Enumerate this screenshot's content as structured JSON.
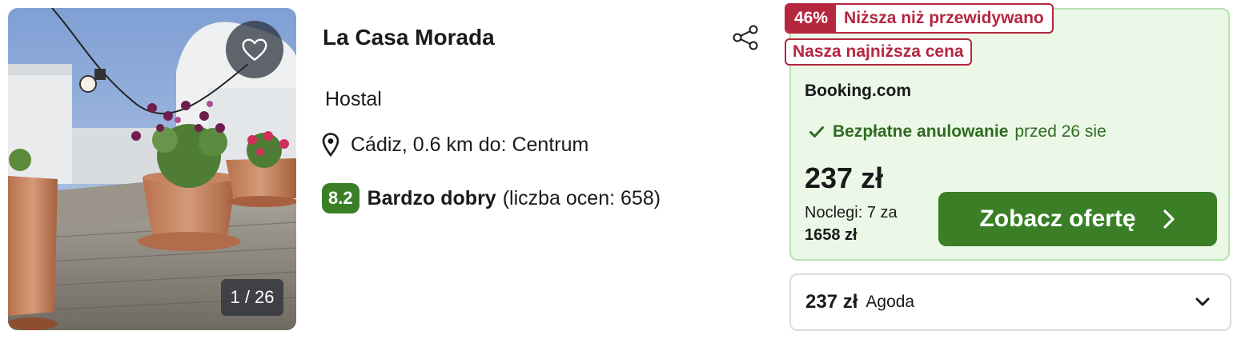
{
  "hotel": {
    "name": "La Casa Morada",
    "type": "Hostal",
    "location": "Cádiz, 0.6 km do: Centrum",
    "rating": {
      "score": "8.2",
      "label": "Bardzo dobry",
      "count_text": "(liczba ocen: 658)"
    }
  },
  "gallery": {
    "counter": "1 / 26",
    "favorite_icon": "heart-icon"
  },
  "deal": {
    "discount_pct": "46%",
    "discount_text": "Niższa niż przewidywano",
    "lowest_badge": "Nasza najniższa cena",
    "provider": "Booking.com",
    "cancellation": {
      "label": "Bezpłatne anulowanie",
      "date": "przed 26 sie"
    },
    "price": "237 zł",
    "nights_text": "Noclegi: 7 za",
    "total": "1658 zł",
    "cta_label": "Zobacz ofertę"
  },
  "alternative": {
    "price": "237 zł",
    "provider": "Agoda"
  },
  "colors": {
    "green": "#3a7f26",
    "green_dark": "#2e6b1f",
    "deal_bg": "#ebf8e8",
    "deal_border": "#b8e2b0",
    "badge_red": "#b5263f"
  },
  "icons": {
    "share": "share-icon",
    "location": "map-pin-icon",
    "check": "check-icon",
    "cta_arrow": "chevron-right-icon",
    "expand": "chevron-down-icon"
  }
}
